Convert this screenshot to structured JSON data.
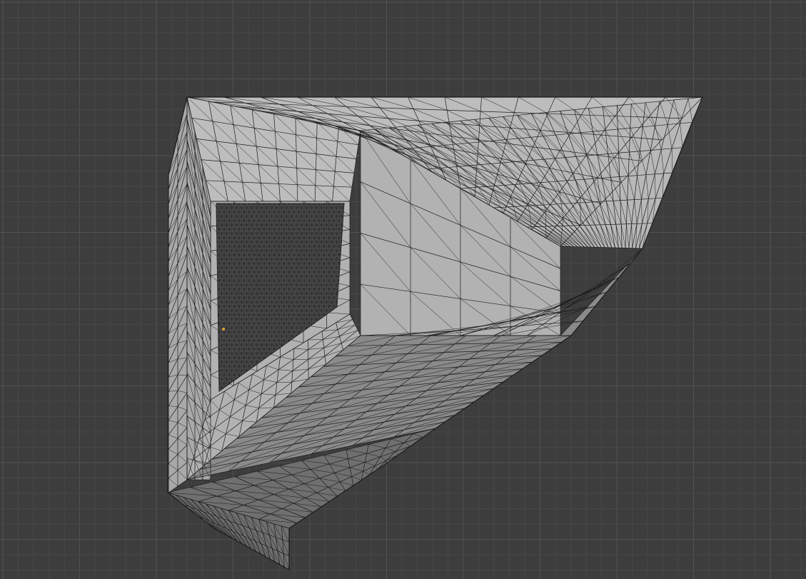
{
  "viewport": {
    "background_color": "#3d3d3d",
    "grid_minor_color": "#474747",
    "grid_major_color": "#525252"
  },
  "mesh": {
    "edge_color": "#1c1c1c",
    "face_colors": {
      "top_lit": "#bdbdbd",
      "front_lit": "#b2b2b2",
      "inner_wall": "#a9a9a9",
      "shaded_front": "#8a8a8a",
      "dark_bottom": "#6f6f6f",
      "pocket_dark": "#343434",
      "right_fan": "#b8b8b8"
    }
  }
}
